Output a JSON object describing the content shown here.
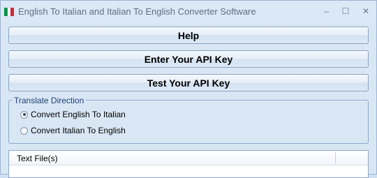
{
  "window": {
    "title": "English To Italian and Italian To English Converter Software",
    "controls": {
      "minimize": "–",
      "maximize": "☐",
      "close": "✕"
    }
  },
  "buttons": {
    "help": "Help",
    "enter_api_key": "Enter Your API Key",
    "test_api_key": "Test Your API Key"
  },
  "translate_direction": {
    "legend": "Translate Direction",
    "options": [
      {
        "label": "Convert English To Italian",
        "selected": true
      },
      {
        "label": "Convert Italian To English",
        "selected": false
      }
    ]
  },
  "file_list": {
    "columns": [
      "Text File(s)",
      ""
    ]
  },
  "colors": {
    "italy_green": "#009246",
    "italy_white": "#ffffff",
    "italy_red": "#ce2b37"
  },
  "icons": {
    "app": "italian-flag-icon",
    "minimize": "minimize-icon",
    "maximize": "maximize-icon",
    "close": "close-icon"
  }
}
